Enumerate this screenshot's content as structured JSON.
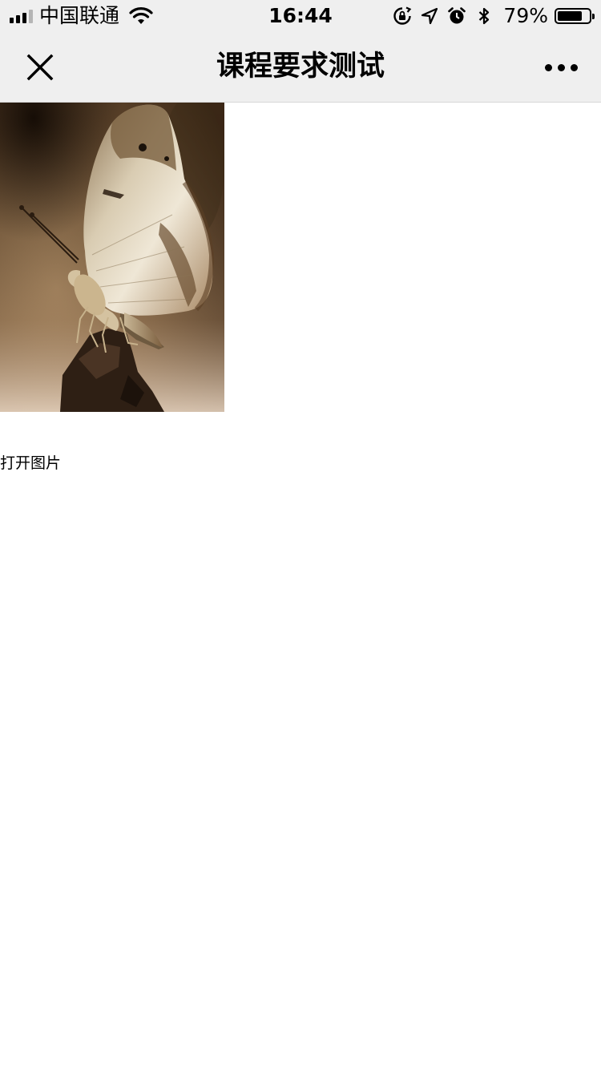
{
  "status_bar": {
    "carrier": "中国联通",
    "time": "16:44",
    "battery_percent": "79%",
    "battery_level": 0.79,
    "icons": [
      "signal-icon",
      "wifi-icon",
      "orientation-lock-icon",
      "location-arrow-icon",
      "alarm-icon",
      "bluetooth-icon",
      "battery-icon"
    ]
  },
  "nav": {
    "title": "课程要求测试",
    "close_icon": "close-icon",
    "more_icon": "more-icon"
  },
  "main": {
    "image_subject": "butterfly",
    "open_link": "打开图片"
  },
  "colors": {
    "bar_background": "#efefef",
    "page_background": "#ffffff",
    "text": "#000000"
  }
}
